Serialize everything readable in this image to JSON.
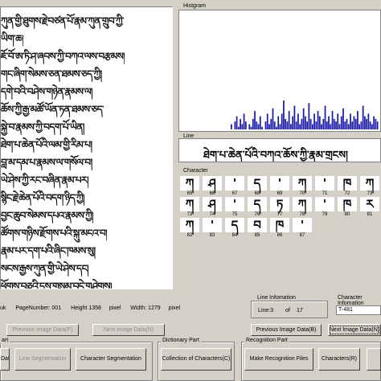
{
  "image_lines": [
    "ཀུན་གྱི་ཐུགས་རྗེ་བཙན་པོ་རྣམ་ཀུན་གྲུབ་ཀྱི་",
    "ཡིག་ཆ།",
    "ཇོ་བོ་ཨ་ཏི་ཤ་ཞབས་ཀྱི་བཀའ་ལས་བརྩམས།",
    "གང་ཞིག་སེམས་ཅན་ཐམས་ཅད་ཀྱི།",
    "དགེ་བའི་བཤེས་གཉེན་རྣམས་ལ།",
    "ཆོས་ཀྱི་རྒྱ་མཚོ་ཡོན་ཏན་ཐམས་ཅད་",
    "སྐྱེ་བ་རྣམས་ཀྱི་བདག་པོ་ཡིན།",
    "ཐེག་པ་ཆེན་པོའི་ལམ་གྱི་རིམ་པ།",
    "བླ་མ་དམ་པ་རྣམས་ལ་གསོལ་བ།",
    "ཡེ་ཤེས་ཀྱི་རང་བཞིན་རྣམ་པར།",
    "སྙིང་རྗེ་ཆེན་པོའི་བདག་ཉིད་ཀྱི།",
    "བྱང་ཆུབ་སེམས་དཔའ་རྣམས་ཀྱི།",
    "ཚོགས་གཉིས་རྫོགས་པའི་སྐུ་མངའ་བ།",
    "རྣམ་པར་དག་པའི་ཞིང་ཁམས་སུ།",
    "སངས་རྒྱས་ཀུན་གྱི་ཡེ་ཤེས་དང།",
    "ཕྱོགས་བཅུའི་དུས་གསུམ་བདེ་གཤེགས།"
  ],
  "histogram": {
    "label": "Histgram",
    "bar_color": "#1a1aa8",
    "values": [
      2,
      0,
      3,
      5,
      1,
      4,
      2,
      6,
      3,
      0,
      2,
      1,
      4,
      7,
      3,
      2,
      5,
      1,
      0,
      3,
      6,
      2,
      4,
      8,
      3,
      1,
      5,
      2,
      6,
      11,
      4,
      3,
      7,
      2,
      5,
      9,
      3,
      6,
      2,
      4,
      8,
      5,
      3,
      10,
      4,
      2,
      6,
      3,
      7,
      5,
      2,
      4,
      9,
      3,
      5,
      2,
      7,
      4,
      3,
      6,
      2,
      5,
      8,
      3,
      4,
      2,
      6,
      3,
      5,
      4,
      7,
      2,
      3,
      9,
      5,
      4,
      6,
      3,
      2,
      5,
      4,
      3
    ]
  },
  "line": {
    "label": "Line",
    "text": "ཐེག་པ་ཆེན་པོའི་བཀའ་ཆོས་ཀྱི་རྣམ་གྲངས།"
  },
  "character": {
    "label": "Character",
    "rows": [
      {
        "cells": [
          {
            "glyph": "ཀ",
            "num": "65"
          },
          {
            "glyph": "ཤ",
            "num": "66"
          },
          {
            "glyph": "'",
            "num": "67"
          },
          {
            "glyph": "ད",
            "num": "68"
          },
          {
            "glyph": "'",
            "num": "69"
          },
          {
            "glyph": "ཀ",
            "num": "70"
          },
          {
            "glyph": "'",
            "num": "71"
          },
          {
            "glyph": "ཁ",
            "num": "72"
          },
          {
            "glyph": "ཀ",
            "num": "73"
          }
        ]
      },
      {
        "cells": [
          {
            "glyph": "ཀ",
            "num": "73"
          },
          {
            "glyph": "ཤ",
            "num": "74"
          },
          {
            "glyph": "'",
            "num": "75"
          },
          {
            "glyph": "ད",
            "num": "76"
          },
          {
            "glyph": "ཏ",
            "num": "77"
          },
          {
            "glyph": "ཀ",
            "num": "78"
          },
          {
            "glyph": "'",
            "num": "79"
          },
          {
            "glyph": "ཁ",
            "num": "80"
          },
          {
            "glyph": "ར",
            "num": "81"
          }
        ]
      },
      {
        "cells": [
          {
            "glyph": "ཀ",
            "num": "82"
          },
          {
            "glyph": "'",
            "num": "83"
          },
          {
            "glyph": "ད",
            "num": "84"
          },
          {
            "glyph": "བ",
            "num": "85"
          },
          {
            "glyph": "ཁ",
            "num": "86"
          },
          {
            "glyph": "'",
            "num": "87"
          }
        ]
      }
    ]
  },
  "status": {
    "name": "uk",
    "page_number": "PageNumber: 001",
    "height": "Height 1358",
    "height_unit": "pixel",
    "width": "Width: 1279",
    "width_unit": "pixel"
  },
  "line_info": {
    "label": "Line Infomation",
    "line": "Line:3",
    "of": "of",
    "total": "17"
  },
  "char_info": {
    "label": "Character Infomation",
    "value": "T-481"
  },
  "buttons": {
    "previous_image_left": "Previous Image Data(P)",
    "next_image_left": "Next Image Data(N)",
    "previous_image_right": "Previous Image Data(B)",
    "next_image_right": "Next Image Data(N)",
    "image_data": "Data",
    "line_segmentation": "Line Segmentation",
    "character_segmentation": "Character Segmentation",
    "collection_of_characters": "Collection of Characters(C)",
    "make_recognition_files": "Make Recognition Files",
    "characters": "Characters(R)"
  },
  "parts": {
    "segmentation_label": "art",
    "dictionary_label": "Dictionary Part",
    "recognition_label": "Recognition Part"
  }
}
